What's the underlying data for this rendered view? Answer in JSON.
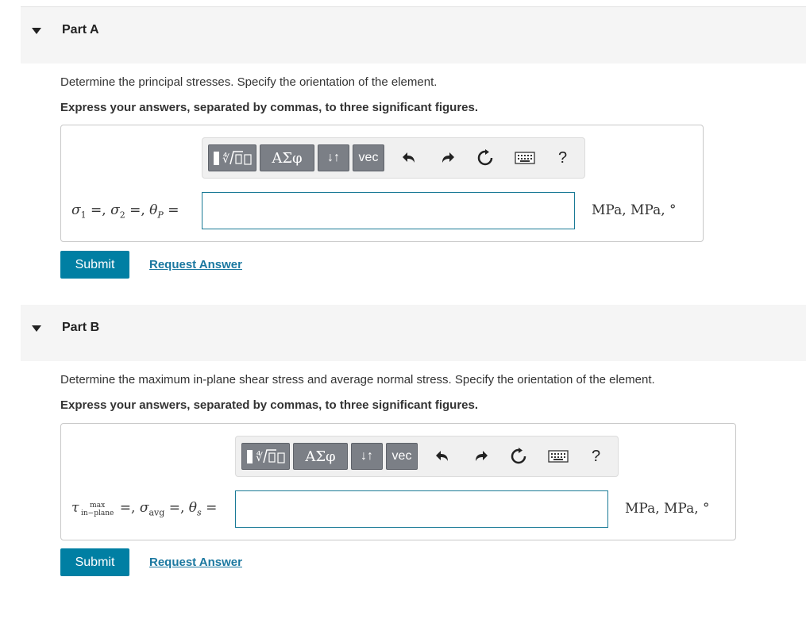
{
  "colors": {
    "accent": "#007fa3",
    "link": "#1b78a0",
    "input_border": "#1a7a96",
    "toolbar_button": "#7b7f86",
    "header_bg": "#f5f5f5"
  },
  "toolbar": {
    "templates_icon": "templates-icon",
    "greek_label": "ΑΣφ",
    "arrows_label": "↓↑",
    "vec_label": "vec",
    "undo_icon": "undo-icon",
    "redo_icon": "redo-icon",
    "reset_icon": "reset-icon",
    "keyboard_icon": "keyboard-icon",
    "help_label": "?"
  },
  "part_a": {
    "title": "Part A",
    "question": "Determine the principal stresses. Specify the orientation of the element.",
    "instruction": "Express your answers, separated by commas, to three significant figures.",
    "label": {
      "sigma1": "σ",
      "sigma1_sub": "1",
      "sep1": " =, ",
      "sigma2": "σ",
      "sigma2_sub": "2",
      "sep2": " =, ",
      "theta": "θ",
      "theta_sub": "P",
      "eq": " ="
    },
    "input_value": "",
    "units": "MPa,  MPa,  °",
    "submit_label": "Submit",
    "request_label": "Request Answer"
  },
  "part_b": {
    "title": "Part B",
    "question": "Determine the maximum in-plane shear stress and average normal stress. Specify the orientation of the element.",
    "instruction": "Express your answers, separated by commas, to three significant figures.",
    "label": {
      "tau": "τ",
      "tau_top": "max",
      "tau_bottom": "in−plane",
      "sep1": " =, ",
      "sigma": "σ",
      "sigma_sub": "avg",
      "sep2": " =, ",
      "theta": "θ",
      "theta_sub": "s",
      "eq": " ="
    },
    "input_value": "",
    "units": "MPa,  MPa,  °",
    "submit_label": "Submit",
    "request_label": "Request Answer"
  }
}
